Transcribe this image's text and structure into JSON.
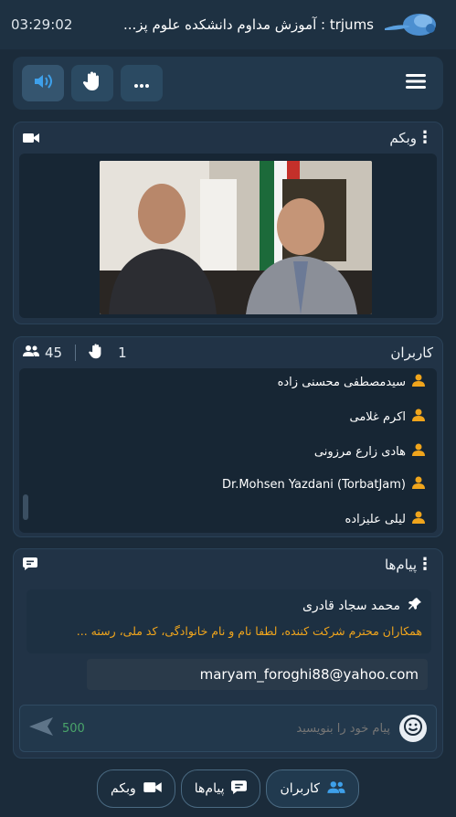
{
  "header": {
    "clock": "03:29:02",
    "title": "trjums : آموزش مداوم دانشکده علوم پز..."
  },
  "toolbar": {
    "buttons": [
      "speaker-icon",
      "raise-hand-icon",
      "more-icon"
    ],
    "menu_icon": "hamburger-icon"
  },
  "webcam_panel": {
    "title": "وبکم",
    "icon": "video-camera-icon"
  },
  "users_panel": {
    "title": "کاربران",
    "user_count": "45",
    "raised_hands": "1",
    "users": [
      "سیدمصطفی محسنی زاده",
      "اکرم غلامی",
      "هادی زارع مرزونی",
      "Dr.Mohsen Yazdani (TorbatJam)",
      "لیلی علیزاده"
    ]
  },
  "messages_panel": {
    "title": "پیام‌ها",
    "pinned_author": "محمد سجاد قادری",
    "pinned_text": "همکاران محترم شرکت کننده، لطفا نام و نام خانوادگی، کد ملی، رسته ...",
    "last_message": "maryam_foroghi88@yahoo.com",
    "input_placeholder": "پیام خود را بنویسید",
    "char_counter": "500"
  },
  "bottom_nav": {
    "users_label": "کاربران",
    "messages_label": "پیام‌ها",
    "webcam_label": "وبکم"
  },
  "colors": {
    "background": "#1b2b3a",
    "panel": "#213346",
    "accent": "#2f8fd8",
    "user_icon": "#f0a51c",
    "pinned_text": "#f0a51c",
    "counter": "#4aa56a"
  }
}
